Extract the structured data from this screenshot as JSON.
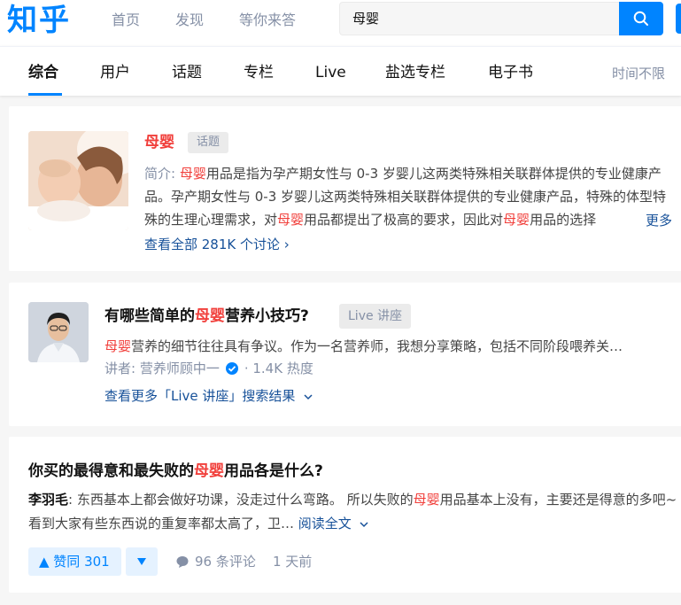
{
  "header": {
    "logo": "知乎",
    "nav": [
      "首页",
      "发现",
      "等你来答"
    ],
    "search_value": "母婴"
  },
  "tabs": {
    "items": [
      "综合",
      "用户",
      "话题",
      "专栏",
      "Live",
      "盐选专栏",
      "电子书"
    ],
    "active": "综合",
    "time_filter": "时间不限"
  },
  "topic_card": {
    "title": "母婴",
    "tag": "话题",
    "desc_prefix": "简介: ",
    "desc_hl1": "母婴",
    "desc_part1": "用品是指为孕产期女性与 0-3 岁婴儿这两类特殊相关联群体提供的专业健康产品。孕产期女性与 0-3 岁婴儿这两类特殊相关联群体提供的专业健康产品，特殊的体型特殊的生理心理需求，对",
    "desc_hl2": "母婴",
    "desc_part2": "用品都提出了极高的要求，因此对",
    "desc_hl3": "母婴",
    "desc_part3": "用品的选择",
    "more": "更多",
    "discussions": "查看全部 281K 个讨论 ›"
  },
  "live_card": {
    "title_pre": "有哪些简单的",
    "title_hl": "母婴",
    "title_post": "营养小技巧?",
    "tag": "Live 讲座",
    "desc_hl": "母婴",
    "desc": "营养的细节往往具有争议。作为一名营养师，我想分享策略，包括不同阶段喂养关…",
    "speaker": "讲者: 营养师顾中一",
    "heat": "· 1.4K 热度",
    "more": "查看更多「Live 讲座」搜索结果"
  },
  "answer_card": {
    "title_pre": "你买的最得意和最失败的",
    "title_hl": "母婴",
    "title_post": "用品各是什么?",
    "author": "李羽毛",
    "body_pre": ": 东西基本上都会做好功课，没走过什么弯路。 所以失败的",
    "body_hl": "母婴",
    "body_post": "用品基本上没有，主要还是得意的多吧~ 看到大家有些东西说的重复率都太高了，卫…",
    "read_more": "阅读全文",
    "upvote": "▲ 赞同 301",
    "comments": "96 条评论",
    "time": "1 天前"
  },
  "colors": {
    "brand": "#0084ff",
    "highlight": "#f1403c",
    "link": "#175199",
    "muted": "#8590a6"
  }
}
